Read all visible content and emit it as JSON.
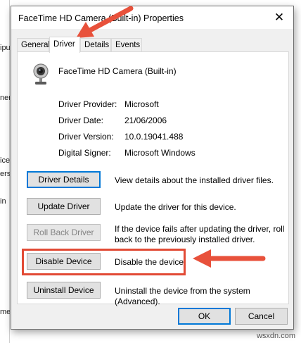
{
  "background": {
    "fragments": [
      "ipu",
      "nera",
      "ices",
      "ers",
      "in",
      "me"
    ]
  },
  "dialog": {
    "title": "FaceTime HD Camera (Built-in) Properties",
    "close_glyph": "✕"
  },
  "tabs": [
    {
      "label": "General"
    },
    {
      "label": "Driver"
    },
    {
      "label": "Details"
    },
    {
      "label": "Events"
    }
  ],
  "active_tab": "Driver",
  "device": {
    "icon": "webcam-icon",
    "name": "FaceTime HD Camera (Built-in)"
  },
  "properties": [
    {
      "label": "Driver Provider:",
      "value": "Microsoft"
    },
    {
      "label": "Driver Date:",
      "value": "21/06/2006"
    },
    {
      "label": "Driver Version:",
      "value": "10.0.19041.488"
    },
    {
      "label": "Digital Signer:",
      "value": "Microsoft Windows"
    }
  ],
  "actions": [
    {
      "label": "Driver Details",
      "description": "View details about the installed driver files."
    },
    {
      "label": "Update Driver",
      "description": "Update the driver for this device."
    },
    {
      "label": "Roll Back Driver",
      "description": "If the device fails after updating the driver, roll back to the previously installed driver."
    },
    {
      "label": "Disable Device",
      "description": "Disable the device."
    },
    {
      "label": "Uninstall Device",
      "description": "Uninstall the device from the system (Advanced)."
    }
  ],
  "footer": {
    "ok_label": "OK",
    "cancel_label": "Cancel"
  },
  "annotations": {
    "highlight_color": "#e24a35",
    "arrow_color": "#e8513b"
  },
  "watermark": "wsxdn.com"
}
